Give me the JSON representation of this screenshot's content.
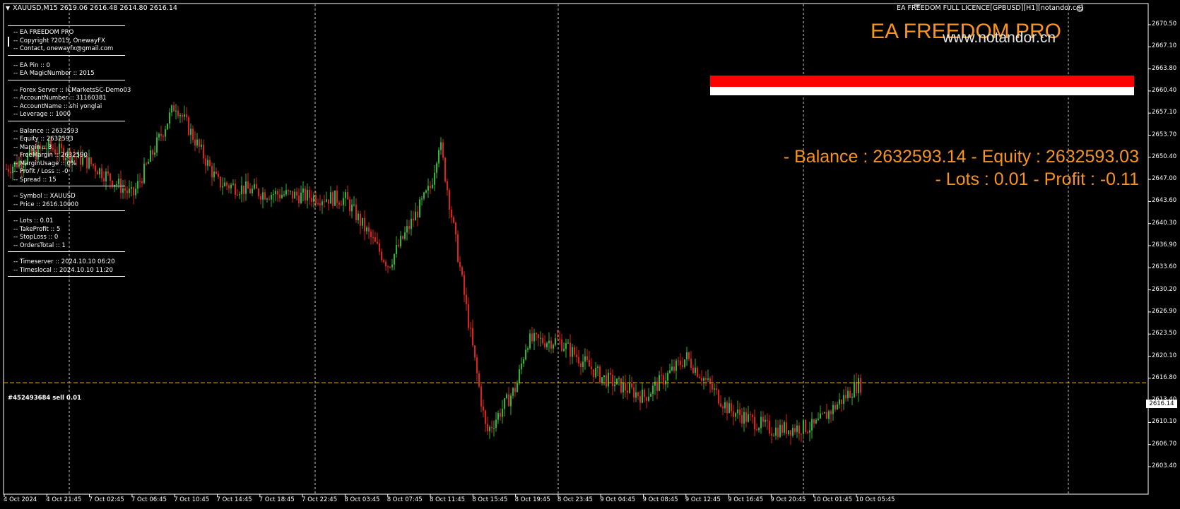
{
  "header": {
    "symbol_title": "XAUUSD,M15  2619.06 2616.48 2614.80 2616.14",
    "licence": "EA FREEDOM FULL LICENCE[GPBUSD][H1][notandor.cn]",
    "smiley": "☺"
  },
  "ea": {
    "title": "EA FREEDOM PRO",
    "watermark": "www.notandor.cn",
    "stat_line1": "- Balance : 2632593.14 - Equity : 2632593.03",
    "stat_line2": "- Lots : 0.01 - Profit : -0.11",
    "colors": {
      "accent": "#f7931e",
      "bar_red": "#ff0000",
      "bar_white": "#ffffff"
    }
  },
  "info_panel": {
    "groups": [
      [
        "-- EA FREEDOM PRO",
        "-- Copyright ?2015, OnewayFX",
        "-- Contact, onewayfx@gmail.com"
      ],
      [
        "-- EA Pin :: 0",
        "-- EA MagicNumber :: 2015"
      ],
      [
        "-- Forex Server :: ICMarketsSC-Demo03",
        "-- AccountNumber :: 31160381",
        "-- AccountName :: shi yonglai",
        "-- Leverage :: 1000"
      ],
      [
        "-- Balance :: 2632593",
        "-- Equity :: 2632593",
        "-- Margin :: 3",
        "-- FreeMargin :: 2632590",
        "-- MarginUsage :: 0%",
        "-- Profit / Loss :: -0",
        "-- Spread :: 15"
      ],
      [
        "-- Symbol :: XAUUSD",
        "-- Price :: 2616.10000"
      ],
      [
        "-- Lots :: 0.01",
        "-- TakeProfit :: 5",
        "-- StopLoss :: 0",
        "-- OrdersTotal :: 1"
      ],
      [
        "-- Timeserver :: 2024.10.10 06:20",
        "-- Timeslocal :: 2024.10.10 11:20"
      ]
    ]
  },
  "order_line": {
    "label": "#452493684 sell 0.01",
    "price": 2616.14,
    "price_label": "2616.14"
  },
  "chart_data": {
    "type": "candlestick",
    "symbol": "XAUUSD",
    "timeframe": "M15",
    "colors": {
      "up": "#2db92d",
      "down": "#e0201a",
      "grid": "#c8c8c8",
      "order_line": "#e8b800"
    },
    "y_ticks": [
      "2670.50",
      "2667.10",
      "2663.80",
      "2660.40",
      "2657.10",
      "2653.70",
      "2650.40",
      "2647.00",
      "2643.60",
      "2640.30",
      "2636.90",
      "2633.60",
      "2630.20",
      "2626.90",
      "2623.50",
      "2620.10",
      "2616.80",
      "2613.40",
      "2610.10",
      "2606.70",
      "2603.40"
    ],
    "y_range": [
      2603.4,
      2670.5
    ],
    "x_ticks": [
      "4 Oct 2024",
      "4 Oct 21:45",
      "7 Oct 02:45",
      "7 Oct 06:45",
      "7 Oct 10:45",
      "7 Oct 14:45",
      "7 Oct 18:45",
      "7 Oct 22:45",
      "8 Oct 03:45",
      "8 Oct 07:45",
      "8 Oct 11:45",
      "8 Oct 15:45",
      "8 Oct 19:45",
      "8 Oct 23:45",
      "9 Oct 04:45",
      "9 Oct 08:45",
      "9 Oct 12:45",
      "9 Oct 16:45",
      "9 Oct 20:45",
      "10 Oct 01:45",
      "10 Oct 05:45"
    ],
    "day_separators": [
      "4 Oct 21:45",
      "7 Oct 22:45",
      "8 Oct 19:45",
      "8 Oct 23:45",
      "9 Oct 20:45",
      "10 Oct 05:45"
    ],
    "close_path": [
      [
        "4 Oct 2024",
        2648.5
      ],
      [
        "4 Oct 21:45",
        2652.0
      ],
      [
        "7 Oct 02:45",
        2649.5
      ],
      [
        "7 Oct 06:45",
        2644.5
      ],
      [
        "7 Oct 10:45",
        2658.5
      ],
      [
        "7 Oct 14:45",
        2646.5
      ],
      [
        "7 Oct 18:45",
        2645.0
      ],
      [
        "7 Oct 22:45",
        2644.5
      ],
      [
        "8 Oct 03:45",
        2644.0
      ],
      [
        "8 Oct 07:45",
        2634.0
      ],
      [
        "8 Oct 11:45",
        2646.0
      ],
      [
        "8 Oct 12:45",
        2653.0
      ],
      [
        "8 Oct 15:45",
        2620.5
      ],
      [
        "8 Oct 16:45",
        2608.5
      ],
      [
        "8 Oct 19:45",
        2615.5
      ],
      [
        "8 Oct 20:45",
        2622.5
      ],
      [
        "8 Oct 23:45",
        2622.5
      ],
      [
        "9 Oct 04:45",
        2617.0
      ],
      [
        "9 Oct 08:45",
        2614.0
      ],
      [
        "9 Oct 12:45",
        2620.0
      ],
      [
        "9 Oct 16:45",
        2612.0
      ],
      [
        "9 Oct 20:45",
        2609.0
      ],
      [
        "10 Oct 01:45",
        2609.5
      ],
      [
        "10 Oct 05:45",
        2615.8
      ]
    ]
  }
}
